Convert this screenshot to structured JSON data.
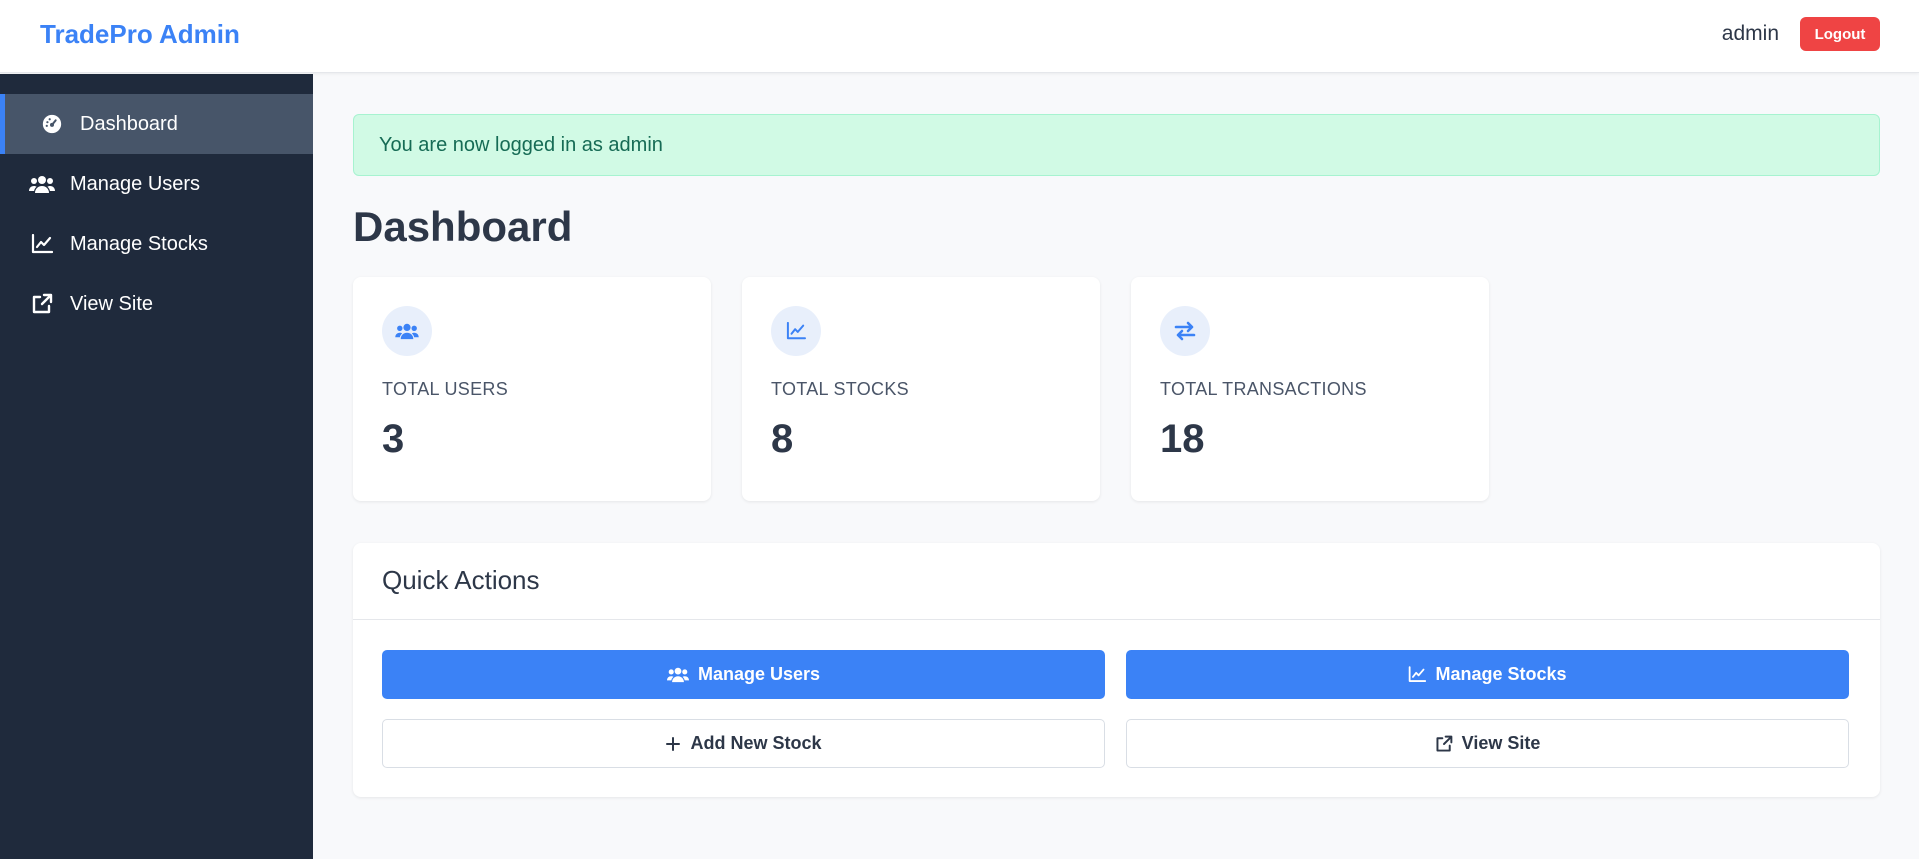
{
  "header": {
    "brand": "TradePro Admin",
    "user": "admin",
    "logout_label": "Logout"
  },
  "sidebar": {
    "items": [
      {
        "label": "Dashboard",
        "icon": "dashboard-gauge-icon",
        "active": true
      },
      {
        "label": "Manage Users",
        "icon": "users-icon",
        "active": false
      },
      {
        "label": "Manage Stocks",
        "icon": "chart-line-icon",
        "active": false
      },
      {
        "label": "View Site",
        "icon": "external-link-icon",
        "active": false
      }
    ]
  },
  "alert": {
    "message": "You are now logged in as admin"
  },
  "main": {
    "title": "Dashboard",
    "stats": [
      {
        "label": "TOTAL USERS",
        "value": "3",
        "icon": "users-icon"
      },
      {
        "label": "TOTAL STOCKS",
        "value": "8",
        "icon": "chart-line-icon"
      },
      {
        "label": "TOTAL TRANSACTIONS",
        "value": "18",
        "icon": "exchange-arrows-icon"
      }
    ],
    "quick_actions": {
      "title": "Quick Actions",
      "buttons": [
        {
          "label": "Manage Users",
          "icon": "users-icon",
          "style": "primary"
        },
        {
          "label": "Manage Stocks",
          "icon": "chart-line-icon",
          "style": "primary"
        },
        {
          "label": "Add New Stock",
          "icon": "plus-icon",
          "style": "outline"
        },
        {
          "label": "View Site",
          "icon": "external-link-icon",
          "style": "outline"
        }
      ]
    }
  },
  "colors": {
    "brand": "#3b82f6",
    "sidebar_bg": "#1f2a3c",
    "danger": "#ef4444",
    "alert_bg": "#d1fae5",
    "alert_text": "#166b55"
  }
}
